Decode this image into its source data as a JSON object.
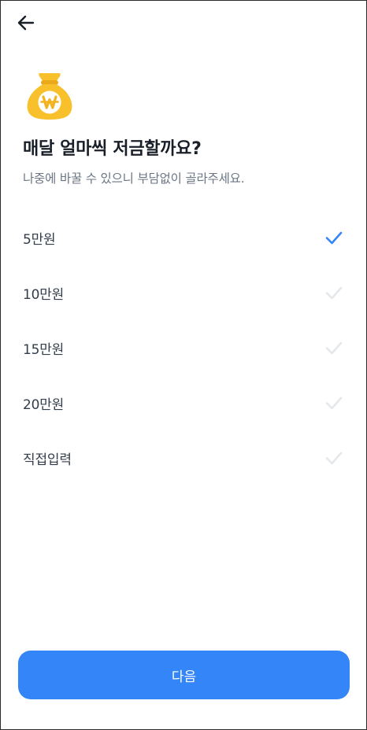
{
  "header": {
    "back_icon": "arrow-left-icon",
    "illustration_icon": "money-bag-won-icon"
  },
  "title": "매달 얼마씩 저금할까요?",
  "subtitle": "나중에 바꿀 수 있으니 부담없이 골라주세요.",
  "options": [
    {
      "label": "5만원",
      "selected": true
    },
    {
      "label": "10만원",
      "selected": false
    },
    {
      "label": "15만원",
      "selected": false
    },
    {
      "label": "20만원",
      "selected": false
    },
    {
      "label": "직접입력",
      "selected": false
    }
  ],
  "next_button": {
    "label": "다음"
  },
  "colors": {
    "accent": "#3485f7",
    "check_inactive": "#e5e8eb",
    "bag_body": "#f8c02a",
    "bag_dark": "#e9a91a",
    "title": "#191f28",
    "subtitle": "#6b7684",
    "option_text": "#333d4b"
  }
}
